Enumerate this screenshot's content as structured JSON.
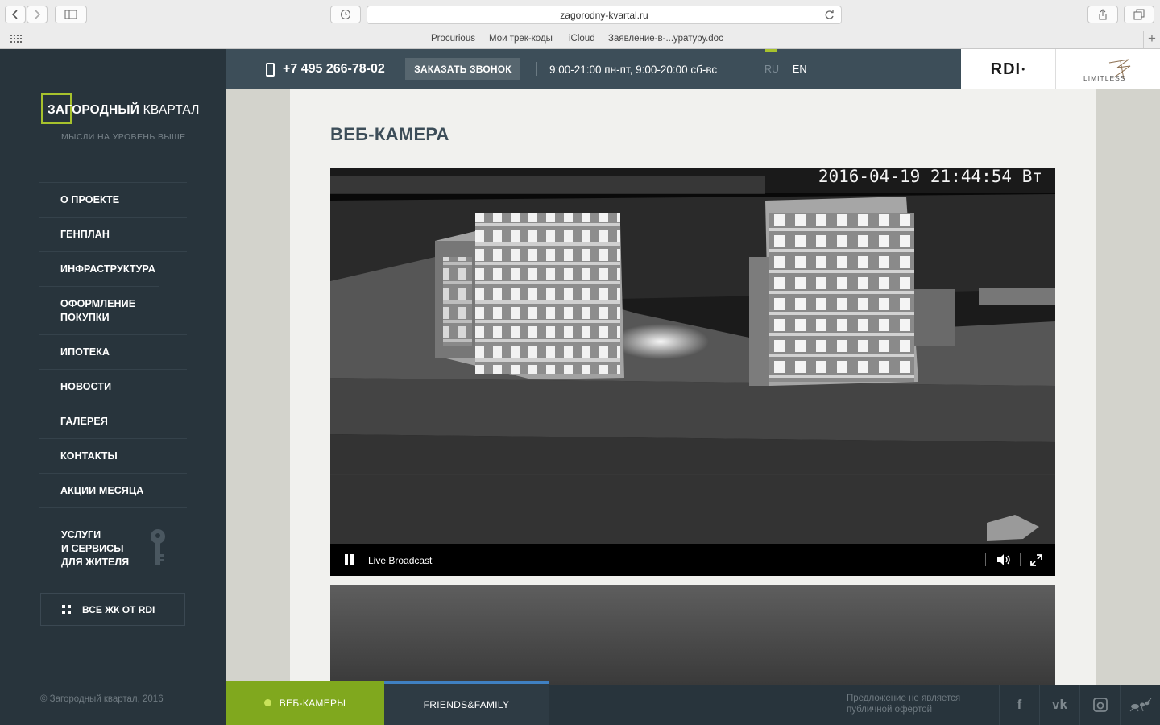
{
  "browser": {
    "url": "zagorodny-kvartal.ru",
    "bookmarks": [
      "Procurious",
      "Мои трек-коды",
      "iCloud",
      "Заявление-в-...уратуру.doc"
    ]
  },
  "site": {
    "logo_bold": "ЗАГОРОДНЫЙ",
    "logo_light": "КВАРТАЛ",
    "tagline": "МЫСЛИ НА УРОВЕНЬ ВЫШЕ",
    "nav": [
      "О ПРОЕКТЕ",
      "ГЕНПЛАН",
      "ИНФРАСТРУКТУРА",
      "ОФОРМЛЕНИЕ ПОКУПКИ",
      "ИПОТЕКА",
      "НОВОСТИ",
      "ГАЛЕРЕЯ",
      "КОНТАКТЫ",
      "АКЦИИ МЕСЯЦА"
    ],
    "services_line1": "УСЛУГИ",
    "services_line2": "И СЕРВИСЫ",
    "services_line3": "ДЛЯ ЖИТЕЛЯ",
    "all_zk": "ВСЕ ЖК ОТ RDI"
  },
  "header": {
    "phone": "+7 495 266-78-02",
    "call_button": "ЗАКАЗАТЬ ЗВОНОК",
    "hours": "9:00-21:00 пн-пт, 9:00-20:00 сб-вс",
    "lang_ru": "RU",
    "lang_en": "EN",
    "brand_rdi": "RDI",
    "brand_limitless": "LIMITLESS"
  },
  "main": {
    "title": "ВЕБ-КАМЕРА",
    "timestamp": "2016-04-19 21:44:54 Вт",
    "player_status": "Live Broadcast"
  },
  "footer": {
    "copyright": "© Загородный квартал, 2016",
    "tab_webcams": "ВЕБ-КАМЕРЫ",
    "tab_friends": "FRIENDS&FAMILY",
    "offer_line1": "Предложение не является",
    "offer_line2": "публичной офертой",
    "social": [
      "f",
      "vk",
      "instagram",
      "ant"
    ]
  },
  "colors": {
    "accent_green": "#a7c22d",
    "sidebar": "#28343c",
    "topbar": "#3d4e59",
    "tab_blue": "#3f80c2"
  }
}
